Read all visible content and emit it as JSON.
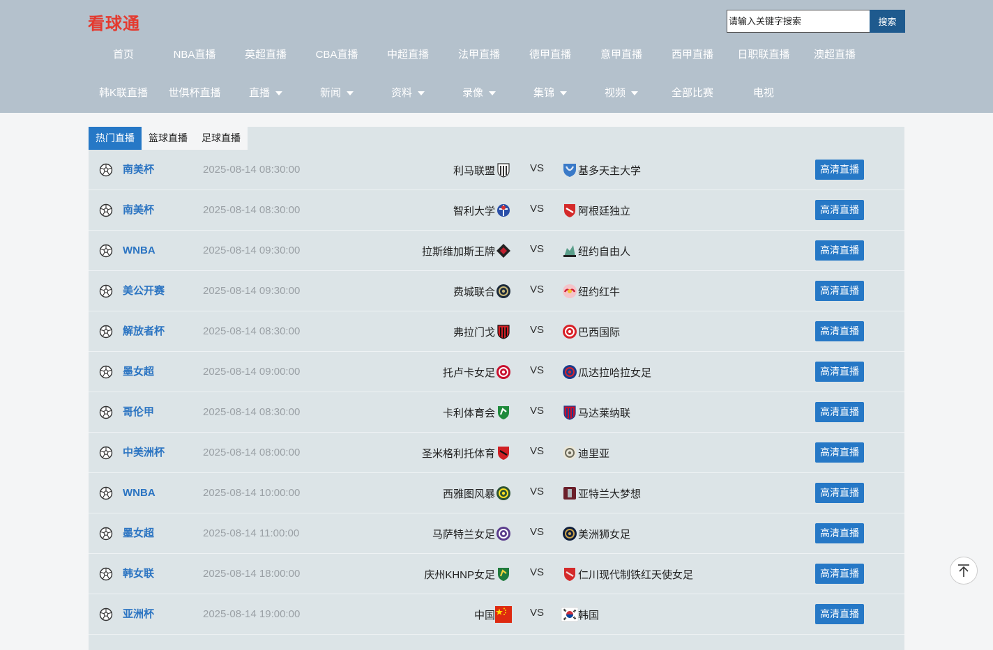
{
  "site": {
    "logo": "看球通"
  },
  "search": {
    "placeholder": "请输入关键字搜索",
    "button": "搜索"
  },
  "nav_row1": [
    "首页",
    "NBA直播",
    "英超直播",
    "CBA直播",
    "中超直播",
    "法甲直播",
    "德甲直播",
    "意甲直播",
    "西甲直播",
    "日职联直播",
    "澳超直播"
  ],
  "nav_row2": [
    {
      "label": "韩K联直播",
      "dropdown": false
    },
    {
      "label": "世俱杯直播",
      "dropdown": false
    },
    {
      "label": "直播",
      "dropdown": true
    },
    {
      "label": "新闻",
      "dropdown": true
    },
    {
      "label": "资料",
      "dropdown": true
    },
    {
      "label": "录像",
      "dropdown": true
    },
    {
      "label": "集锦",
      "dropdown": true
    },
    {
      "label": "视频",
      "dropdown": true
    },
    {
      "label": "全部比赛",
      "dropdown": false
    },
    {
      "label": "电视",
      "dropdown": false
    }
  ],
  "tabs": [
    {
      "label": "热门直播",
      "active": true
    },
    {
      "label": "篮球直播",
      "active": false
    },
    {
      "label": "足球直播",
      "active": false
    }
  ],
  "vs_label": "VS",
  "live_label": "高清直播",
  "matches": [
    {
      "league": "南美杯",
      "time": "2025-08-14 08:30:00",
      "home": "利马联盟",
      "home_icon": "striped-shield-icon",
      "home_colors": [
        "#ffffff",
        "#333333"
      ],
      "away": "基多天主大学",
      "away_icon": "blue-crest-icon",
      "away_colors": [
        "#3a7ac8",
        "#e0e8f5"
      ]
    },
    {
      "league": "南美杯",
      "time": "2025-08-14 08:30:00",
      "home": "智利大学",
      "home_icon": "blue-red-crest-icon",
      "home_colors": [
        "#2a4fa8",
        "#d63030"
      ],
      "away": "阿根廷独立",
      "away_icon": "red-shield-icon",
      "away_colors": [
        "#d42a2a",
        "#ffffff"
      ]
    },
    {
      "league": "WNBA",
      "time": "2025-08-14 09:30:00",
      "home": "拉斯维加斯王牌",
      "home_icon": "diamond-icon",
      "home_colors": [
        "#222222",
        "#c21f2f"
      ],
      "away": "纽约自由人",
      "away_icon": "statue-icon",
      "away_colors": [
        "#5a9e8a",
        "#222222"
      ]
    },
    {
      "league": "美公开赛",
      "time": "2025-08-14 09:30:00",
      "home": "费城联合",
      "home_icon": "round-badge-icon",
      "home_colors": [
        "#1c2a3a",
        "#c9b778"
      ],
      "away": "纽约红牛",
      "away_icon": "bull-badge-icon",
      "away_colors": [
        "#d1213a",
        "#f5c4c9"
      ]
    },
    {
      "league": "解放者杯",
      "time": "2025-08-14 08:30:00",
      "home": "弗拉门戈",
      "home_icon": "striped-shield-icon",
      "home_colors": [
        "#d01f24",
        "#111111"
      ],
      "away": "巴西国际",
      "away_icon": "round-badge-icon",
      "away_colors": [
        "#d81f26",
        "#ffffff"
      ]
    },
    {
      "league": "墨女超",
      "time": "2025-08-14 09:00:00",
      "home": "托卢卡女足",
      "home_icon": "round-badge-icon",
      "home_colors": [
        "#c8102e",
        "#ffffff"
      ],
      "away": "瓜达拉哈拉女足",
      "away_icon": "round-badge-icon",
      "away_colors": [
        "#1b3b8a",
        "#d9232d"
      ]
    },
    {
      "league": "哥伦甲",
      "time": "2025-08-14 08:30:00",
      "home": "卡利体育会",
      "home_icon": "green-shield-icon",
      "home_colors": [
        "#1f8a3c",
        "#ffffff"
      ],
      "away": "马达莱纳联",
      "away_icon": "striped-shield-icon",
      "away_colors": [
        "#c8102e",
        "#1c3c8c"
      ]
    },
    {
      "league": "中美洲杯",
      "time": "2025-08-14 08:00:00",
      "home": "圣米格利托体育",
      "home_icon": "red-shield-icon",
      "home_colors": [
        "#d01f24",
        "#111111"
      ],
      "away": "迪里亚",
      "away_icon": "round-badge-icon",
      "away_colors": [
        "#e9e6d8",
        "#6c6a5a"
      ]
    },
    {
      "league": "WNBA",
      "time": "2025-08-14 10:00:00",
      "home": "西雅图风暴",
      "home_icon": "round-badge-icon",
      "home_colors": [
        "#2c5234",
        "#fbe122"
      ],
      "away": "亚特兰大梦想",
      "away_icon": "square-badge-icon",
      "away_colors": [
        "#6b1f2a",
        "#b0b7bc"
      ]
    },
    {
      "league": "墨女超",
      "time": "2025-08-14 11:00:00",
      "home": "马萨特兰女足",
      "home_icon": "round-badge-icon",
      "home_colors": [
        "#5a3c8c",
        "#ffffff"
      ],
      "away": "美洲狮女足",
      "away_icon": "round-badge-icon",
      "away_colors": [
        "#0e1e3c",
        "#c9a14a"
      ]
    },
    {
      "league": "韩女联",
      "time": "2025-08-14 18:00:00",
      "home": "庆州KHNP女足",
      "home_icon": "green-shield-icon",
      "home_colors": [
        "#1f7a3c",
        "#f0d33c"
      ],
      "away": "仁川现代制铁红天使女足",
      "away_icon": "red-shield-icon",
      "away_colors": [
        "#d42a2a",
        "#f4d7d7"
      ]
    },
    {
      "league": "亚洲杯",
      "time": "2025-08-14 19:00:00",
      "home": "中国",
      "home_icon": "china-flag-icon",
      "home_colors": [
        "#de2910",
        "#ffde00"
      ],
      "away": "韩国",
      "away_icon": "korea-flag-icon",
      "away_colors": [
        "#ffffff",
        "#cd2e3a"
      ]
    }
  ]
}
